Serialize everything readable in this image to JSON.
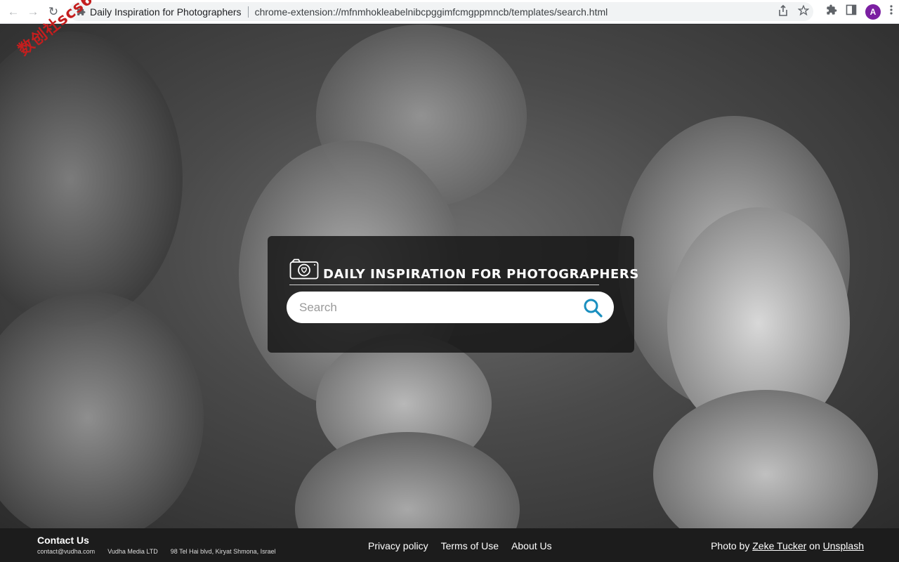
{
  "browser": {
    "tab_title": "Daily Inspiration for Photographers",
    "url": "chrome-extension://mfnmhokleabelnibcpggimfcmgppmncb/templates/search.html",
    "avatar_letter": "A"
  },
  "watermark": "数创社scs66",
  "panel": {
    "brand": "DAILY INSPIRATION FOR PHOTOGRAPHERS",
    "search_placeholder": "Search"
  },
  "footer": {
    "contact_title": "Contact Us",
    "email": "contact@vudha.com",
    "company": "Vudha Media LTD",
    "address": "98 Tel Hai blvd, Kiryat Shmona, Israel",
    "links": [
      "Privacy policy",
      "Terms of Use",
      "About Us"
    ],
    "credit_prefix": "Photo by",
    "photographer": "Zeke Tucker",
    "credit_on": "on",
    "source": "Unsplash"
  },
  "colors": {
    "accent": "#1a8fbf",
    "avatar": "#7b1fa2"
  }
}
